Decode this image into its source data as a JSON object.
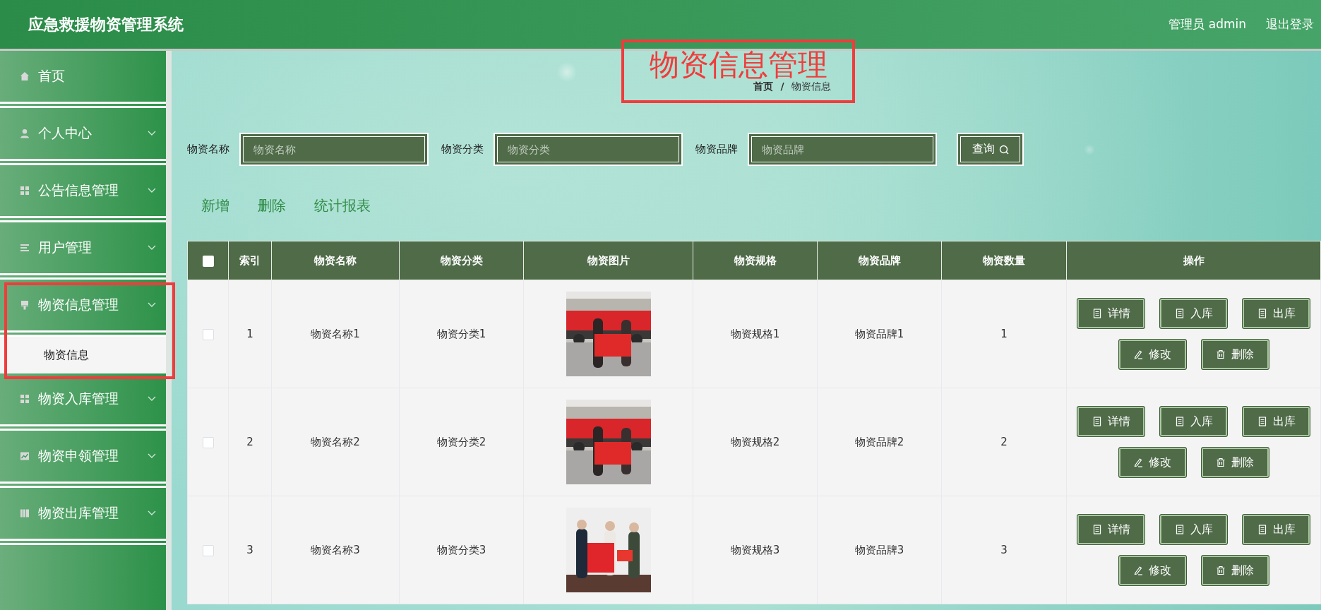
{
  "header": {
    "title": "应急救援物资管理系统",
    "user": "管理员 admin",
    "logout": "退出登录"
  },
  "sidebar": {
    "items": [
      {
        "label": "首页",
        "kind": "link"
      },
      {
        "label": "个人中心",
        "kind": "menu"
      },
      {
        "label": "公告信息管理",
        "kind": "menu"
      },
      {
        "label": "用户管理",
        "kind": "menu"
      },
      {
        "label": "物资信息管理",
        "kind": "menu",
        "children": [
          {
            "label": "物资信息"
          }
        ]
      },
      {
        "label": "物资入库管理",
        "kind": "menu"
      },
      {
        "label": "物资申领管理",
        "kind": "menu"
      },
      {
        "label": "物资出库管理",
        "kind": "menu"
      }
    ]
  },
  "annotation": {
    "title": "物资信息管理"
  },
  "breadcrumb": {
    "items": [
      "首页",
      "物资信息"
    ],
    "separator": "/"
  },
  "search": {
    "fields": [
      {
        "label": "物资名称",
        "placeholder": "物资名称"
      },
      {
        "label": "物资分类",
        "placeholder": "物资分类"
      },
      {
        "label": "物资品牌",
        "placeholder": "物资品牌"
      }
    ],
    "button": "查询"
  },
  "actions": [
    "新增",
    "删除",
    "统计报表"
  ],
  "table": {
    "header_checked": false,
    "columns": [
      {
        "label": "索引",
        "kind": "text"
      },
      {
        "label": "物资名称",
        "kind": "text"
      },
      {
        "label": "物资分类",
        "kind": "text"
      },
      {
        "label": "物资图片",
        "kind": "picture"
      },
      {
        "label": "物资规格",
        "kind": "text"
      },
      {
        "label": "物资品牌",
        "kind": "text"
      },
      {
        "label": "物资数量",
        "kind": "text"
      },
      {
        "label": "操作",
        "kind": "actions"
      }
    ],
    "rows": [
      {
        "checked": false,
        "cells": [
          "1",
          "物资名称1",
          "物资分类1",
          {
            "kind": "picture"
          },
          "物资规格1",
          "物资品牌1",
          "1"
        ],
        "buttons": [
          {
            "label": "详情",
            "kind": "document"
          },
          {
            "label": "入库",
            "kind": "document"
          },
          {
            "label": "出库",
            "kind": "document"
          },
          {
            "label": "修改",
            "kind": "edit"
          },
          {
            "label": "删除",
            "kind": "delete"
          }
        ]
      },
      {
        "checked": false,
        "cells": [
          "2",
          "物资名称2",
          "物资分类2",
          {
            "kind": "picture"
          },
          "物资规格2",
          "物资品牌2",
          "2"
        ],
        "buttons": [
          {
            "label": "详情",
            "kind": "document"
          },
          {
            "label": "入库",
            "kind": "document"
          },
          {
            "label": "出库",
            "kind": "document"
          },
          {
            "label": "修改",
            "kind": "edit"
          },
          {
            "label": "删除",
            "kind": "delete"
          }
        ]
      },
      {
        "checked": false,
        "cells": [
          "3",
          "物资名称3",
          "物资分类3",
          {
            "kind": "picture"
          },
          "物资规格3",
          "物资品牌3",
          "3"
        ],
        "buttons": [
          {
            "label": "详情",
            "kind": "document"
          },
          {
            "label": "入库",
            "kind": "document"
          },
          {
            "label": "出库",
            "kind": "document"
          },
          {
            "label": "修改",
            "kind": "edit"
          },
          {
            "label": "删除",
            "kind": "delete"
          }
        ]
      }
    ]
  }
}
